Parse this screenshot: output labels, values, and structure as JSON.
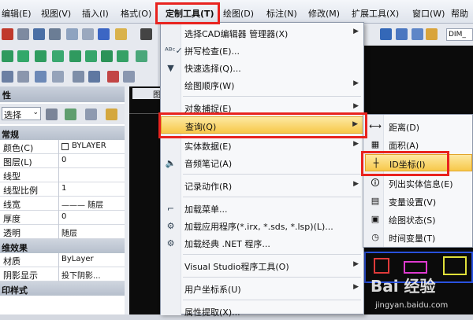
{
  "menubar": {
    "items": [
      "编辑(E)",
      "视图(V)",
      "插入(I)",
      "格式(O)",
      "定制工具(T)",
      "绘图(D)",
      "标注(N)",
      "修改(M)",
      "扩展工具(X)",
      "窗口(W)",
      "帮助"
    ]
  },
  "right_toolbar": {
    "style_name": "DIM_"
  },
  "properties": {
    "title": "性",
    "select_label": "选择",
    "sections": [
      {
        "title": "常规",
        "rows": [
          {
            "k": "颜色(C)",
            "v": "BYLAYER"
          },
          {
            "k": "图层(L)",
            "v": "0"
          },
          {
            "k": "线型",
            "v": ""
          },
          {
            "k": "线型比例",
            "v": "1"
          },
          {
            "k": "线宽",
            "v": "——— 随层"
          },
          {
            "k": "厚度",
            "v": "0"
          },
          {
            "k": "透明",
            "v": "随层"
          }
        ]
      },
      {
        "title": "维效果",
        "rows": [
          {
            "k": "材质",
            "v": "ByLayer"
          },
          {
            "k": "阴影显示",
            "v": "投下阴影..."
          }
        ]
      },
      {
        "title": "印样式",
        "rows": []
      }
    ]
  },
  "canvas": {
    "tab": "图"
  },
  "context_menu": {
    "items": [
      {
        "label": "选择CAD编辑器 管理器(X)",
        "arrow": "▶",
        "icon": "none"
      },
      {
        "label": "拼写检查(E)...",
        "icon": "spell-check-icon",
        "glyph": "ᴬᴮᶜ✓"
      },
      {
        "label": "快速选择(Q)...",
        "icon": "funnel-icon",
        "glyph": "▼"
      },
      {
        "label": "绘图顺序(W)",
        "arrow": "▶",
        "icon": "none"
      },
      {
        "sep": true
      },
      {
        "label": "对象捕捉(E)",
        "arrow": "▶",
        "icon": "none"
      },
      {
        "label": "查询(Q)",
        "arrow": "▶",
        "icon": "none",
        "active": true
      },
      {
        "label": "实体数据(E)",
        "arrow": "▶",
        "icon": "none"
      },
      {
        "label": "音频笔记(A)",
        "icon": "speaker-icon",
        "glyph": "🔈"
      },
      {
        "sep": true
      },
      {
        "label": "记录动作(R)",
        "arrow": "▶",
        "icon": "none"
      },
      {
        "sep": true
      },
      {
        "label": "加载菜单...",
        "icon": "menu-load-icon",
        "glyph": "⌐"
      },
      {
        "label": "加载应用程序(*.irx, *.sds, *.lsp)(L)...",
        "icon": "gear-app-icon",
        "glyph": "⚙"
      },
      {
        "label": "加载经典 .NET 程序...",
        "icon": "gear-net-icon",
        "glyph": "⚙"
      },
      {
        "sep": true
      },
      {
        "label": "Visual Studio程序工具(O)",
        "arrow": "▶",
        "icon": "none"
      },
      {
        "sep": true
      },
      {
        "label": "用户坐标系(U)",
        "arrow": "▶",
        "icon": "none"
      },
      {
        "sep": true
      },
      {
        "label": "属性提取(X)...",
        "icon": "none"
      }
    ]
  },
  "submenu": {
    "items": [
      {
        "label": "距离(D)",
        "icon": "distance-icon",
        "glyph": "⟷"
      },
      {
        "label": "面积(A)",
        "icon": "area-icon",
        "glyph": "▦"
      },
      {
        "label": "ID坐标(I)",
        "icon": "id-coordinate-icon",
        "glyph": "┼",
        "active": true
      },
      {
        "label": "列出实体信息(E)",
        "icon": "list-info-icon",
        "glyph": "🛈"
      },
      {
        "label": "变量设置(V)",
        "icon": "variable-settings-icon",
        "glyph": "▤"
      },
      {
        "label": "绘图状态(S)",
        "icon": "drawing-status-icon",
        "glyph": "▣"
      },
      {
        "label": "时间变量(T)",
        "icon": "clock-icon",
        "glyph": "◷"
      }
    ]
  },
  "watermark": {
    "text": "Bai 经验",
    "url": "jingyan.baidu.com"
  },
  "colors": {
    "highlight_red": "#e8231f",
    "menu_active": "#f7c84a"
  }
}
